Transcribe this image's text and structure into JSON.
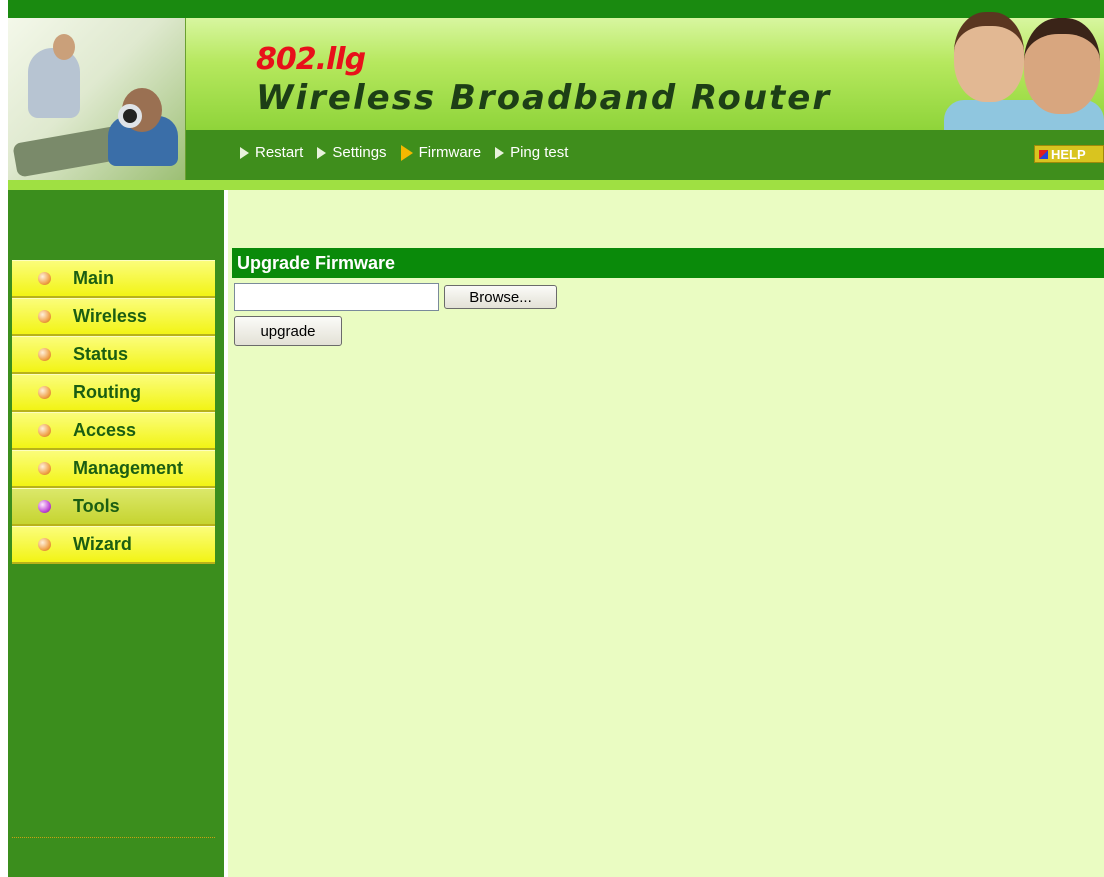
{
  "header": {
    "brand_sub": "802.llg",
    "brand_title": "Wireless Broadband Router",
    "help_label": "HELP",
    "nav": [
      {
        "label": "Restart",
        "active": false
      },
      {
        "label": "Settings",
        "active": false
      },
      {
        "label": "Firmware",
        "active": true
      },
      {
        "label": "Ping test",
        "active": false
      }
    ]
  },
  "sidebar": {
    "items": [
      {
        "label": "Main",
        "active": false
      },
      {
        "label": "Wireless",
        "active": false
      },
      {
        "label": "Status",
        "active": false
      },
      {
        "label": "Routing",
        "active": false
      },
      {
        "label": "Access",
        "active": false
      },
      {
        "label": "Management",
        "active": false
      },
      {
        "label": "Tools",
        "active": true
      },
      {
        "label": "Wizard",
        "active": false
      }
    ]
  },
  "main": {
    "section_title": "Upgrade Firmware",
    "file_input_value": "",
    "browse_label": "Browse...",
    "upgrade_label": "upgrade"
  },
  "colors": {
    "accent_green": "#0a8a0a",
    "sidebar_green": "#3b8e1d",
    "menu_yellow": "#f2f415",
    "content_bg": "#eafcc2",
    "brand_red": "#e8101a"
  }
}
